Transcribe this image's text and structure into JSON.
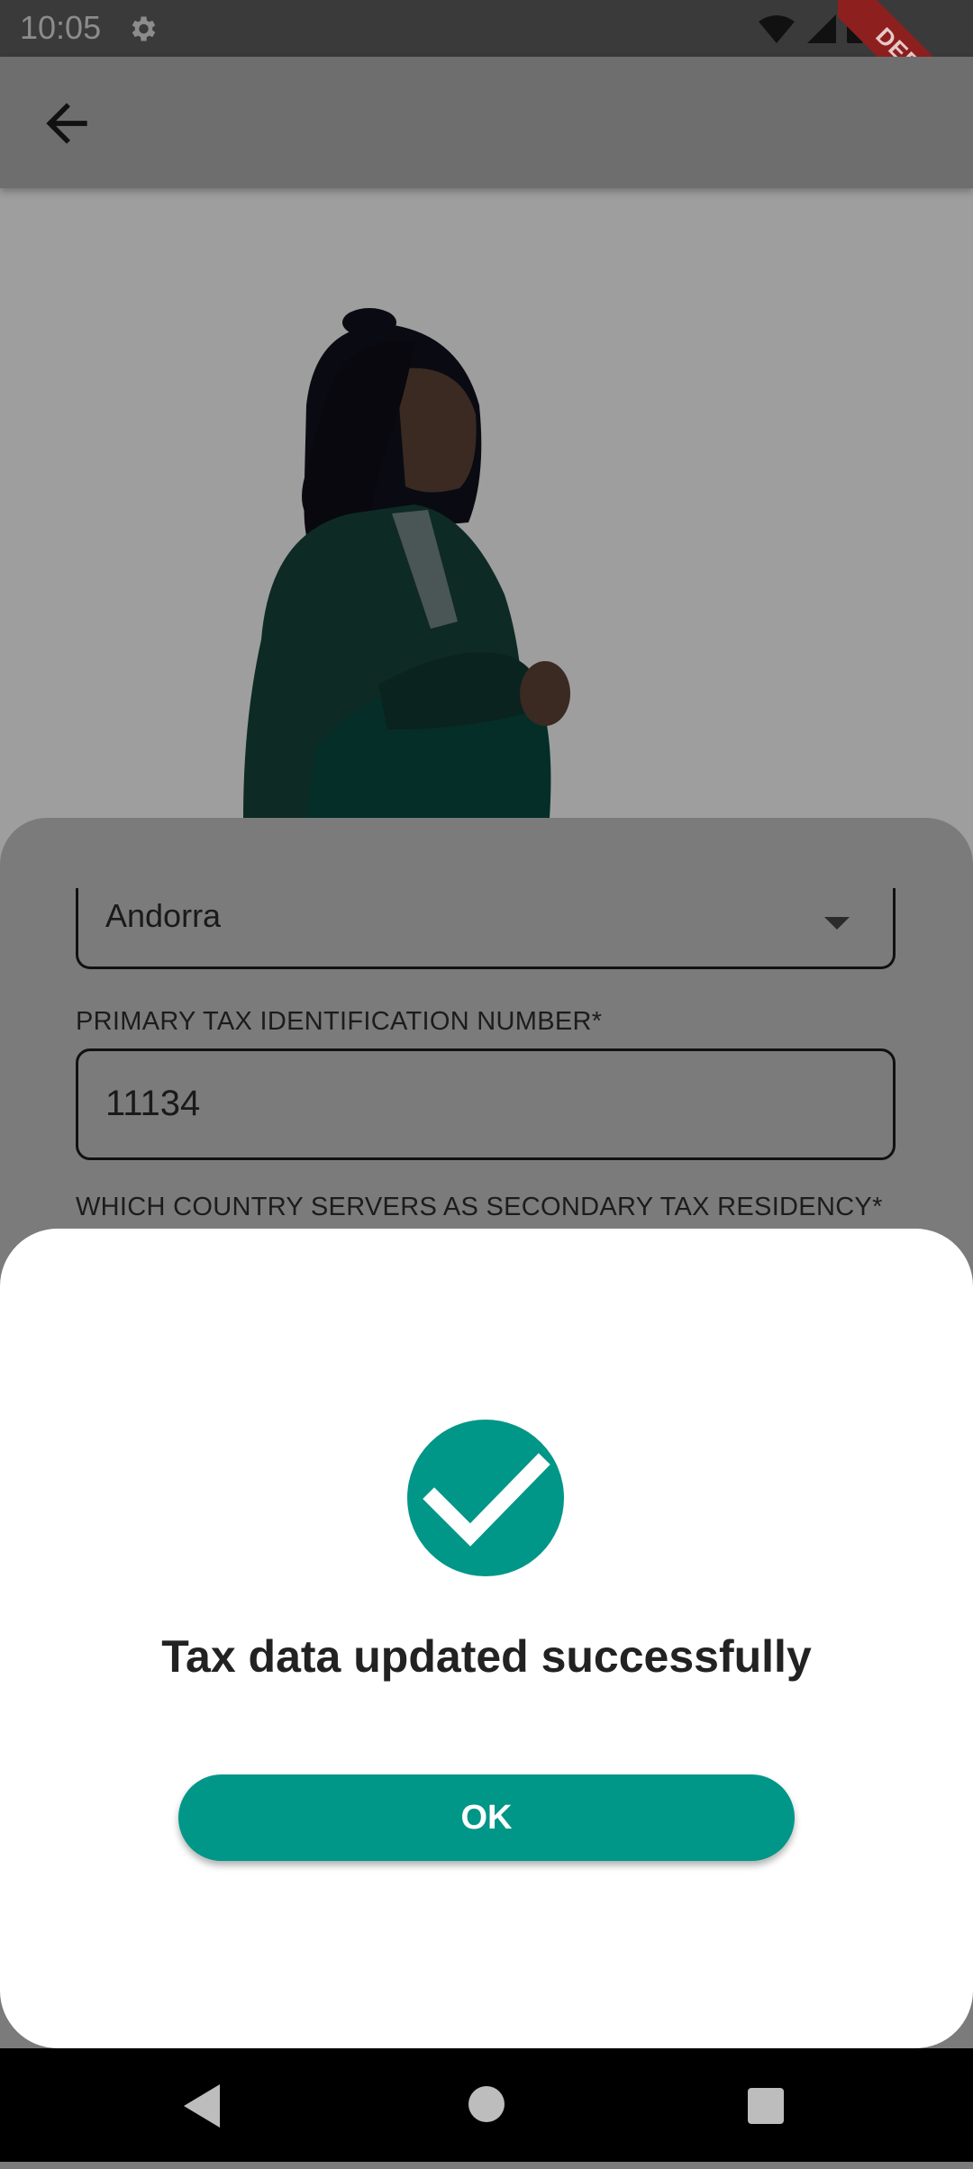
{
  "status_bar": {
    "time": "10:05"
  },
  "debug_banner": "DEBUG",
  "form": {
    "country_value": "Andorra",
    "primary_tin_label": "PRIMARY TAX IDENTIFICATION NUMBER*",
    "primary_tin_value": "11134",
    "secondary_label": "WHICH COUNTRY SERVERS AS SECONDARY TAX RESIDENCY*"
  },
  "dialog": {
    "message": "Tax data updated successfully",
    "ok_label": "OK"
  },
  "colors": {
    "accent": "#009688",
    "overlay": "#7b7b7b",
    "status_bar": "#3a3a3a",
    "debug": "#8e1f1f"
  },
  "icons": [
    "settings-icon",
    "wifi-icon",
    "signal-icon",
    "battery-icon",
    "back-arrow-icon",
    "dropdown-caret-icon",
    "check-icon",
    "nav-back-icon",
    "nav-home-icon",
    "nav-recents-icon"
  ]
}
